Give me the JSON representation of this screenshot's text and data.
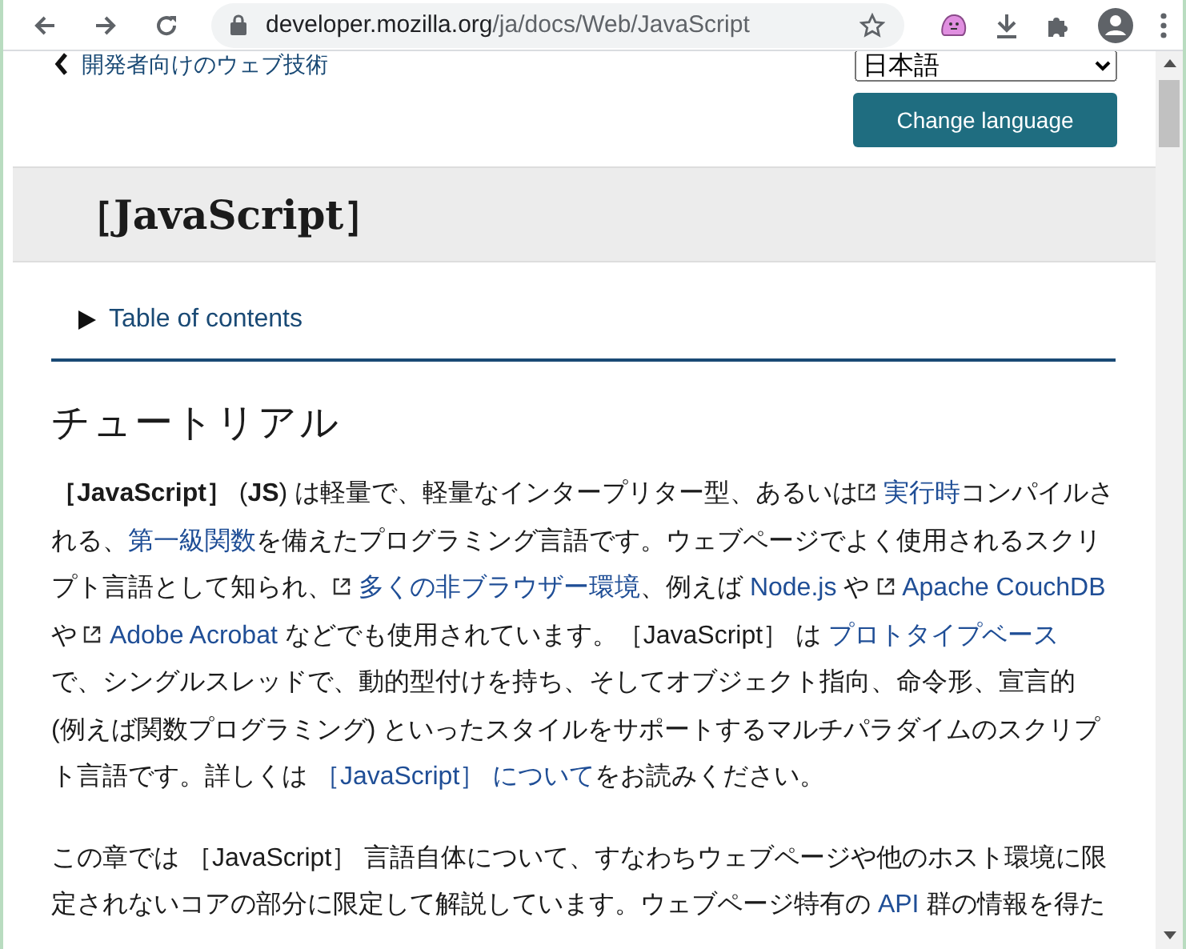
{
  "browser": {
    "url": "developer.mozilla.org/ja/docs/Web/JavaScript"
  },
  "breadcrumb": {
    "label": "開発者向けのウェブ技術"
  },
  "language": {
    "value": "日本語",
    "button": "Change language"
  },
  "title": "［JavaScript］",
  "toc": {
    "label": "Table of contents",
    "expanded": false
  },
  "section": {
    "heading": "チュートリアル",
    "paragraphs": [
      [
        {
          "kind": "bold",
          "text": "［JavaScript］"
        },
        {
          "kind": "text",
          "text": " ("
        },
        {
          "kind": "bold",
          "text": "JS"
        },
        {
          "kind": "text",
          "text": ") は軽量で、軽量なインタープリター型、あるいは"
        },
        {
          "kind": "link",
          "external": true,
          "text": "実行時"
        },
        {
          "kind": "text",
          "text": "コンパイルされる、"
        },
        {
          "kind": "link",
          "external": false,
          "text": "第一級関数"
        },
        {
          "kind": "text",
          "text": "を備えたプログラミング言語です。ウェブページでよく使用されるスクリプト言語として知られ、"
        },
        {
          "kind": "link",
          "external": true,
          "text": "多くの非ブラウザー環境"
        },
        {
          "kind": "text",
          "text": "、例えば "
        },
        {
          "kind": "link",
          "external": false,
          "text": "Node.js"
        },
        {
          "kind": "text",
          "text": " や "
        },
        {
          "kind": "link",
          "external": true,
          "text": "Apache CouchDB"
        },
        {
          "kind": "text",
          "text": " や "
        },
        {
          "kind": "link",
          "external": true,
          "text": "Adobe Acrobat"
        },
        {
          "kind": "text",
          "text": " などでも使用されています。［JavaScript］ は "
        },
        {
          "kind": "link",
          "external": false,
          "text": "プロトタイプベース"
        },
        {
          "kind": "text",
          "text": " で、シングルスレッドで、動的型付けを持ち、そしてオブジェクト指向、命令形、宣言的 (例えば関数プログラミング) といったスタイルをサポートするマルチパラダイムのスクリプト言語です。詳しくは "
        },
        {
          "kind": "link",
          "external": false,
          "text": "［JavaScript］ について"
        },
        {
          "kind": "text",
          "text": "をお読みください。"
        }
      ],
      [
        {
          "kind": "text",
          "text": "この章では ［JavaScript］ 言語自体について、すなわちウェブページや他のホスト環境に限定されないコアの部分に限定して解説しています。ウェブページ特有の "
        },
        {
          "kind": "link",
          "external": false,
          "text": "API"
        },
        {
          "kind": "text",
          "text": " 群の情報を得た"
        }
      ]
    ]
  }
}
